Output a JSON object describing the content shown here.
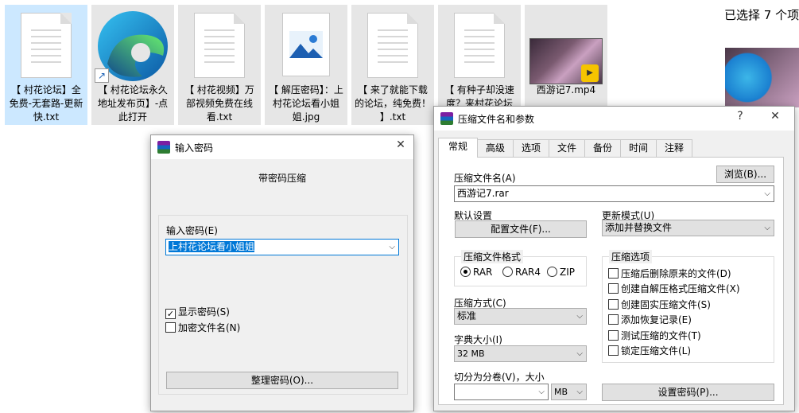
{
  "files": [
    {
      "caption": "【 村花论坛】全免费-无套路-更新快.txt",
      "kind": "txt",
      "selected": true
    },
    {
      "caption": "【 村花论坛永久地址发布页】-点此打开",
      "kind": "edge-shortcut",
      "selected": false
    },
    {
      "caption": "【 村花视频】万部视频免费在线看.txt",
      "kind": "txt",
      "selected": false
    },
    {
      "caption": "【 解压密码】：上村花论坛看小姐姐.jpg",
      "kind": "jpg",
      "selected": false
    },
    {
      "caption": "【 来了就能下载的论坛，纯免费！ 】.txt",
      "kind": "txt",
      "selected": false
    },
    {
      "caption": "【 有种子却没速度？来村花论坛",
      "kind": "txt",
      "selected": false
    },
    {
      "caption": "西游记7.mp4",
      "kind": "mp4",
      "selected": false
    }
  ],
  "details_pane": {
    "selected_text": "已选择 7 个项"
  },
  "password_dialog": {
    "title": "输入密码",
    "heading": "带密码压缩",
    "password_label": "输入密码(E)",
    "password_value": "上村花论坛看小姐姐",
    "show_password_label": "显示密码(S)",
    "show_password_checked": true,
    "encrypt_names_label": "加密文件名(N)",
    "encrypt_names_checked": false,
    "organize_button": "整理密码(O)...",
    "close_icon": "✕"
  },
  "archive_dialog": {
    "title": "压缩文件名和参数",
    "help_icon": "?",
    "close_icon": "✕",
    "tabs": [
      "常规",
      "高级",
      "选项",
      "文件",
      "备份",
      "时间",
      "注释"
    ],
    "active_tab": 0,
    "archive_name_label": "压缩文件名(A)",
    "browse_button": "浏览(B)...",
    "archive_name_value": "西游记7.rar",
    "default_settings_label": "默认设置",
    "profiles_button": "配置文件(F)...",
    "update_mode_label": "更新模式(U)",
    "update_mode_value": "添加并替换文件",
    "format_group_label": "压缩文件格式",
    "formats": [
      {
        "label": "RAR",
        "checked": true
      },
      {
        "label": "RAR4",
        "checked": false
      },
      {
        "label": "ZIP",
        "checked": false
      }
    ],
    "method_label": "压缩方式(C)",
    "method_value": "标准",
    "dict_label": "字典大小(I)",
    "dict_value": "32 MB",
    "split_label": "切分为分卷(V)，大小",
    "split_value": "",
    "split_unit": "MB",
    "options_group_label": "压缩选项",
    "options": [
      {
        "label": "压缩后删除原来的文件(D)",
        "checked": false
      },
      {
        "label": "创建自解压格式压缩文件(X)",
        "checked": false
      },
      {
        "label": "创建固实压缩文件(S)",
        "checked": false
      },
      {
        "label": "添加恢复记录(E)",
        "checked": false
      },
      {
        "label": "测试压缩的文件(T)",
        "checked": false
      },
      {
        "label": "锁定压缩文件(L)",
        "checked": false
      }
    ],
    "set_password_button": "设置密码(P)..."
  }
}
